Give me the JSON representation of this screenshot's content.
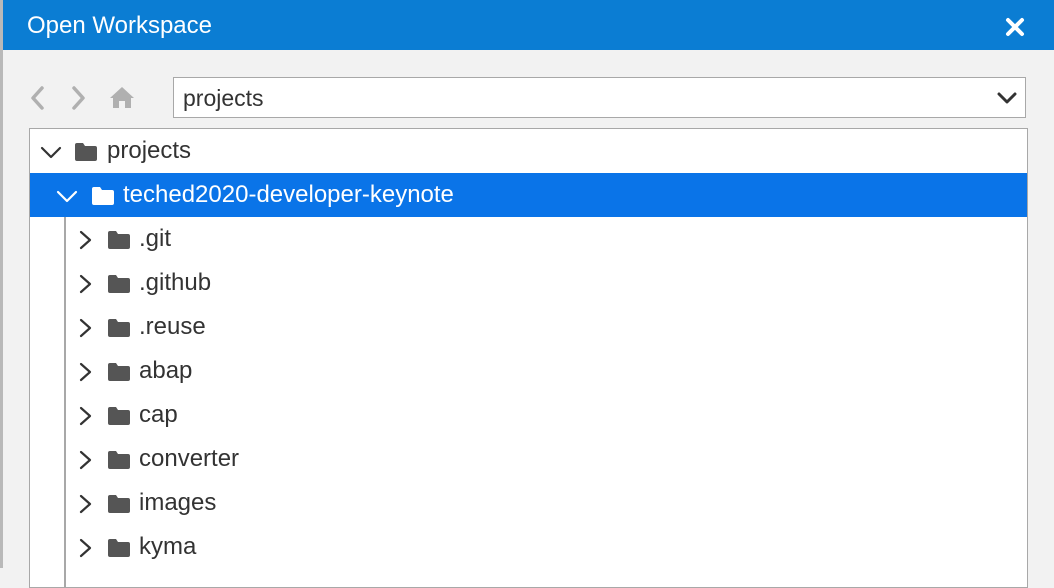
{
  "window": {
    "title": "Open Workspace"
  },
  "icons": {
    "close": "close-icon",
    "back": "chevron-left-icon",
    "forward": "chevron-right-icon",
    "home": "home-icon",
    "dropdown": "chevron-down-icon",
    "folder": "folder-icon"
  },
  "colors": {
    "titlebar": "#0b7dd3",
    "selection": "#0a74e8",
    "folder_icon": "#555555",
    "nav_icon_disabled": "#b0b0b0"
  },
  "location": {
    "selected": "projects"
  },
  "tree": {
    "root": {
      "label": "projects",
      "expanded": true
    },
    "selected_folder": {
      "label": "teched2020-developer-keynote",
      "expanded": true,
      "selected": true
    },
    "children": [
      {
        "label": ".git"
      },
      {
        "label": ".github"
      },
      {
        "label": ".reuse"
      },
      {
        "label": "abap"
      },
      {
        "label": "cap"
      },
      {
        "label": "converter"
      },
      {
        "label": "images"
      },
      {
        "label": "kyma"
      }
    ]
  }
}
